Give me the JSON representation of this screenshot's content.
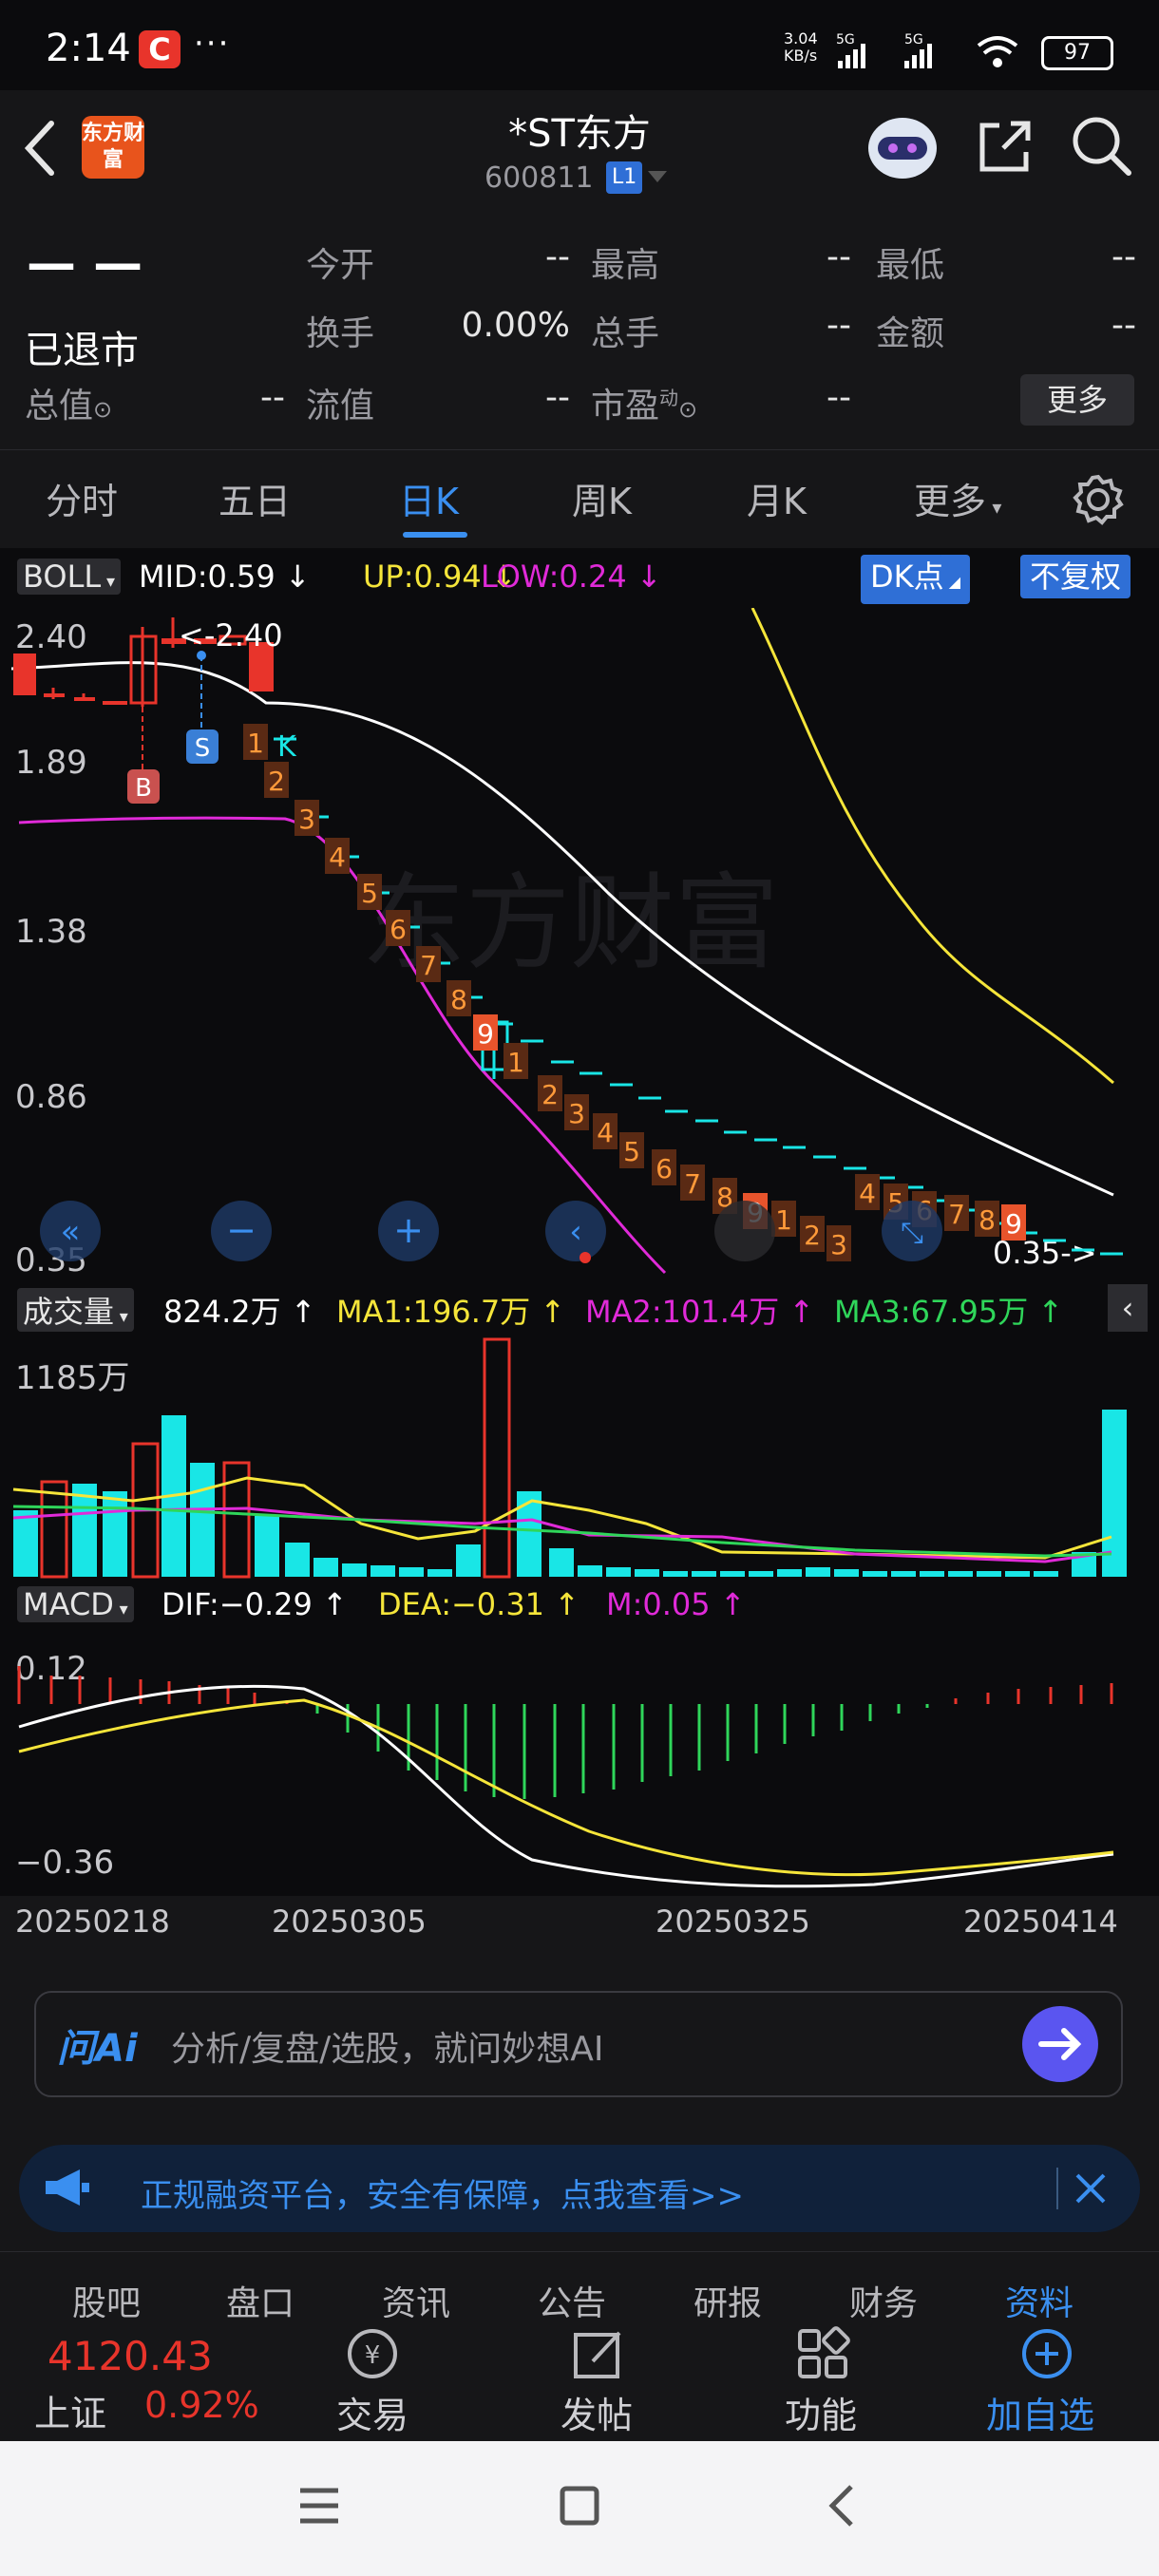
{
  "status": {
    "time": "2:14",
    "notif_app": "C",
    "dots": "···",
    "net_speed": "3.04",
    "net_unit": "KB/s",
    "battery": "97"
  },
  "header": {
    "logo": "东方财富",
    "title": "*ST东方",
    "code": "600811",
    "level": "L1"
  },
  "quote": {
    "price": "— —",
    "status": "已退市",
    "rows": [
      [
        {
          "label": "今开",
          "value": "--"
        },
        {
          "label": "最高",
          "value": "--"
        },
        {
          "label": "最低",
          "value": "--"
        }
      ],
      [
        {
          "label": "换手",
          "value": "0.00%"
        },
        {
          "label": "总手",
          "value": "--"
        },
        {
          "label": "金额",
          "value": "--"
        }
      ]
    ],
    "r3": {
      "zongzhi": "总值",
      "zongzhi_val": "--",
      "liuzhi": "流值",
      "liuzhi_val": "--",
      "shiying": "市盈",
      "shiying_sup": "动",
      "shiying_val": "--"
    },
    "more": "更多"
  },
  "tabs": [
    "分时",
    "五日",
    "日K",
    "周K",
    "月K",
    "更多"
  ],
  "active_tab": "日K",
  "boll": {
    "selector": "BOLL",
    "mid": "MID:0.59 ↓",
    "up": "UP:0.94 ↓",
    "low": "LOW:0.24 ↓",
    "dk": "DK点",
    "fq": "不复权",
    "axis": [
      "2.40",
      "1.89",
      "1.38",
      "0.86",
      "0.35"
    ],
    "high_note": "<-2.40",
    "low_note": "0.35->",
    "watermark": "东方财富",
    "marks": {
      "b": "B",
      "s": "S",
      "k": "K"
    },
    "td": [
      "1",
      "2",
      "3",
      "4",
      "5",
      "6",
      "7",
      "8",
      "9",
      "1",
      "2",
      "3",
      "4",
      "5",
      "6",
      "7",
      "8",
      "9",
      "1",
      "2",
      "3",
      "4",
      "5",
      "6",
      "7",
      "8",
      "9"
    ]
  },
  "volume": {
    "selector": "成交量",
    "value": "824.2万 ↑",
    "ma1": "MA1:196.7万 ↑",
    "ma2": "MA2:101.4万 ↑",
    "ma3": "MA3:67.95万 ↑",
    "axis_top": "1185万"
  },
  "macd": {
    "selector": "MACD",
    "dif": "DIF:−0.29 ↑",
    "dea": "DEA:−0.31 ↑",
    "m": "M:0.05 ↑",
    "axis_top": "0.12",
    "axis_bottom": "−0.36"
  },
  "dates": [
    "20250218",
    "20250305",
    "20250325",
    "20250414"
  ],
  "ai": {
    "logo": "问Ai",
    "placeholder": "分析/复盘/选股，就问妙想AI"
  },
  "ad": {
    "text": "正规融资平台，安全有保障，点我查看>>"
  },
  "bottom_tabs": [
    "股吧",
    "盘口",
    "资讯",
    "公告",
    "研报",
    "财务",
    "资料"
  ],
  "index": {
    "value": "4120.43",
    "name": "上证",
    "change": "0.92%"
  },
  "bottom_buttons": [
    "交易",
    "发帖",
    "功能",
    "加自选"
  ],
  "colors": {
    "up": "#e8342b",
    "down": "#19e6e6",
    "boll_up": "#f5e53a",
    "boll_low": "#e02ad8",
    "mid": "#ffffff",
    "accent": "#3a8ff0"
  },
  "chart_data": {
    "type": "candlestick",
    "x_range": [
      "20250218",
      "20250414"
    ],
    "price_axis": [
      0.35,
      2.4
    ],
    "boll": {
      "mid": 0.59,
      "up": 0.94,
      "low": 0.24
    },
    "closes": [
      2.18,
      2.05,
      2.05,
      2.02,
      2.02,
      2.32,
      2.35,
      2.38,
      2.38,
      2.2,
      1.98,
      1.8,
      1.62,
      1.45,
      1.3,
      1.12,
      0.98,
      0.88,
      0.82,
      0.74,
      0.72,
      0.68,
      0.62,
      0.58,
      0.55,
      0.52,
      0.5,
      0.47,
      0.44,
      0.42,
      0.4,
      0.38,
      0.4,
      0.4,
      0.39,
      0.38,
      0.37,
      0.36,
      0.35,
      0.35
    ]
  }
}
